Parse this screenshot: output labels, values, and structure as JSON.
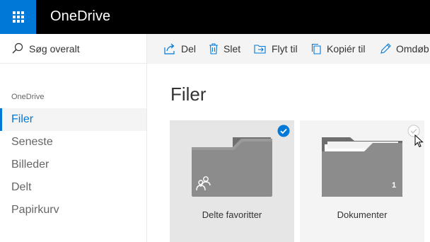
{
  "app": {
    "title": "OneDrive"
  },
  "search": {
    "placeholder": "Søg overalt"
  },
  "nav": {
    "heading": "OneDrive",
    "items": [
      {
        "label": "Filer",
        "selected": true
      },
      {
        "label": "Seneste",
        "selected": false
      },
      {
        "label": "Billeder",
        "selected": false
      },
      {
        "label": "Delt",
        "selected": false
      },
      {
        "label": "Papirkurv",
        "selected": false
      }
    ]
  },
  "commands": [
    {
      "label": "Del",
      "icon": "share-icon"
    },
    {
      "label": "Slet",
      "icon": "trash-icon"
    },
    {
      "label": "Flyt til",
      "icon": "move-icon"
    },
    {
      "label": "Kopiér til",
      "icon": "copy-icon"
    },
    {
      "label": "Omdøb",
      "icon": "rename-icon"
    }
  ],
  "main": {
    "title": "Filer",
    "tiles": [
      {
        "label": "Delte favoritter",
        "selected": true,
        "shared": true,
        "count": ""
      },
      {
        "label": "Dokumenter",
        "selected": false,
        "shared": false,
        "count": "1"
      }
    ]
  },
  "colors": {
    "accent": "#0078d7",
    "topbar": "#000000",
    "folder": "#8a8a8a"
  }
}
